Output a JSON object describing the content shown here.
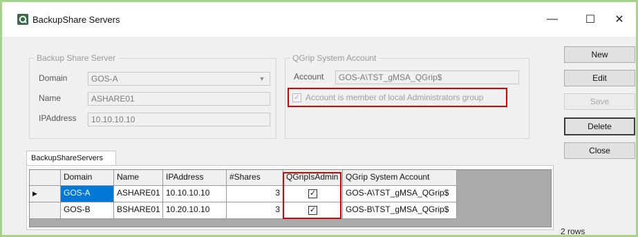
{
  "window": {
    "title": "BackupShare Servers",
    "controls": {
      "minimize": "—",
      "maximize": "☐",
      "close": "✕"
    }
  },
  "server_group": {
    "legend": "Backup Share Server",
    "domain_label": "Domain",
    "domain_value": "GOS-A",
    "name_label": "Name",
    "name_value": "ASHARE01",
    "ip_label": "IPAddress",
    "ip_value": "10.10.10.10"
  },
  "account_group": {
    "legend": "QGrip System Account",
    "account_label": "Account",
    "account_value": "GOS-A\\TST_gMSA_QGrip$",
    "admin_check_label": "Account is member of local Administrators group",
    "admin_checked": true
  },
  "buttons": {
    "new": "New",
    "edit": "Edit",
    "save": "Save",
    "delete": "Delete",
    "close": "Close"
  },
  "tab": {
    "label": "BackupShareServers"
  },
  "grid": {
    "columns": [
      "Domain",
      "Name",
      "IPAddress",
      "#Shares",
      "QGripIsAdmin",
      "QGrip System Account"
    ],
    "rows": [
      {
        "indicator": "▶",
        "domain": "GOS-A",
        "name": "ASHARE01",
        "ip": "10.10.10.10",
        "shares": "3",
        "is_admin": true,
        "account": "GOS-A\\TST_gMSA_QGrip$"
      },
      {
        "indicator": "",
        "domain": "GOS-B",
        "name": "BSHARE01",
        "ip": "10.20.10.10",
        "shares": "3",
        "is_admin": true,
        "account": "GOS-B\\TST_gMSA_QGrip$"
      }
    ],
    "check_mark": "✓"
  },
  "status": {
    "rows_count": "2 rows"
  },
  "colors": {
    "highlight": "#e00000",
    "selection": "#0078d7",
    "outer_border": "#a6d38a"
  }
}
